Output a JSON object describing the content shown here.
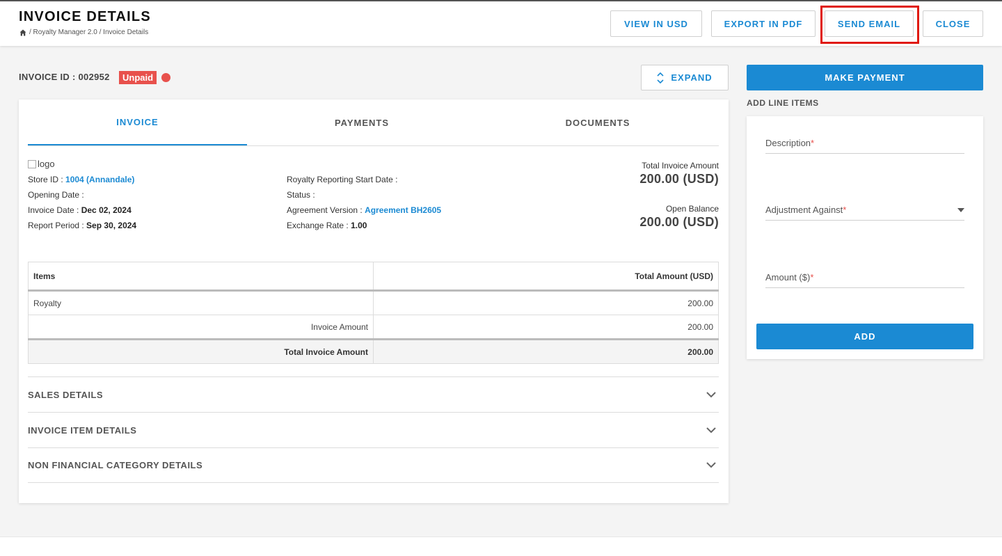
{
  "header": {
    "title": "INVOICE DETAILS",
    "breadcrumb": [
      "/ Royalty Manager 2.0 / Invoice Details"
    ],
    "buttons": {
      "view_usd": "VIEW IN USD",
      "export_pdf": "EXPORT IN PDF",
      "send_email": "SEND EMAIL",
      "close": "CLOSE"
    }
  },
  "invoice": {
    "id_label": "INVOICE ID : 002952",
    "status_badge": "Unpaid",
    "status_color": "#e8514c",
    "expand_label": "EXPAND"
  },
  "tabs": [
    {
      "label": "INVOICE",
      "active": true
    },
    {
      "label": "PAYMENTS",
      "active": false
    },
    {
      "label": "DOCUMENTS",
      "active": false
    }
  ],
  "details": {
    "logo_alt": "logo",
    "store_id_label": "Store ID : ",
    "store_id_value": "1004 (Annandale)",
    "opening_date_label": "Opening Date :",
    "invoice_date_label": "Invoice Date : ",
    "invoice_date_value": "Dec 02, 2024",
    "report_period_label": "Report Period : ",
    "report_period_value": "Sep 30, 2024",
    "royalty_start_label": "Royalty Reporting Start Date :",
    "status_label": "Status :",
    "agreement_label": "Agreement Version : ",
    "agreement_value": "Agreement BH2605",
    "exchange_label": "Exchange Rate : ",
    "exchange_value": "1.00",
    "total_invoice_label": "Total Invoice Amount",
    "total_invoice_value": "200.00 (USD)",
    "open_balance_label": "Open Balance",
    "open_balance_value": "200.00 (USD)"
  },
  "items_table": {
    "headers": [
      "Items",
      "Total Amount (USD)"
    ],
    "rows": [
      {
        "item": "Royalty",
        "amount": "200.00"
      },
      {
        "item": "Invoice Amount",
        "amount": "200.00"
      }
    ],
    "total": {
      "label": "Total Invoice Amount",
      "amount": "200.00"
    }
  },
  "sections": [
    "SALES DETAILS",
    "INVOICE ITEM DETAILS",
    "NON FINANCIAL CATEGORY DETAILS"
  ],
  "side": {
    "make_payment": "MAKE PAYMENT",
    "add_line_items": "ADD LINE ITEMS",
    "description_label": "Description",
    "adjustment_label": "Adjustment Against",
    "amount_label": "Amount ($)",
    "required_mark": "*",
    "add_button": "ADD"
  },
  "colors": {
    "accent": "#1b8ad3",
    "danger": "#e8514c",
    "highlight": "#e0190f"
  }
}
